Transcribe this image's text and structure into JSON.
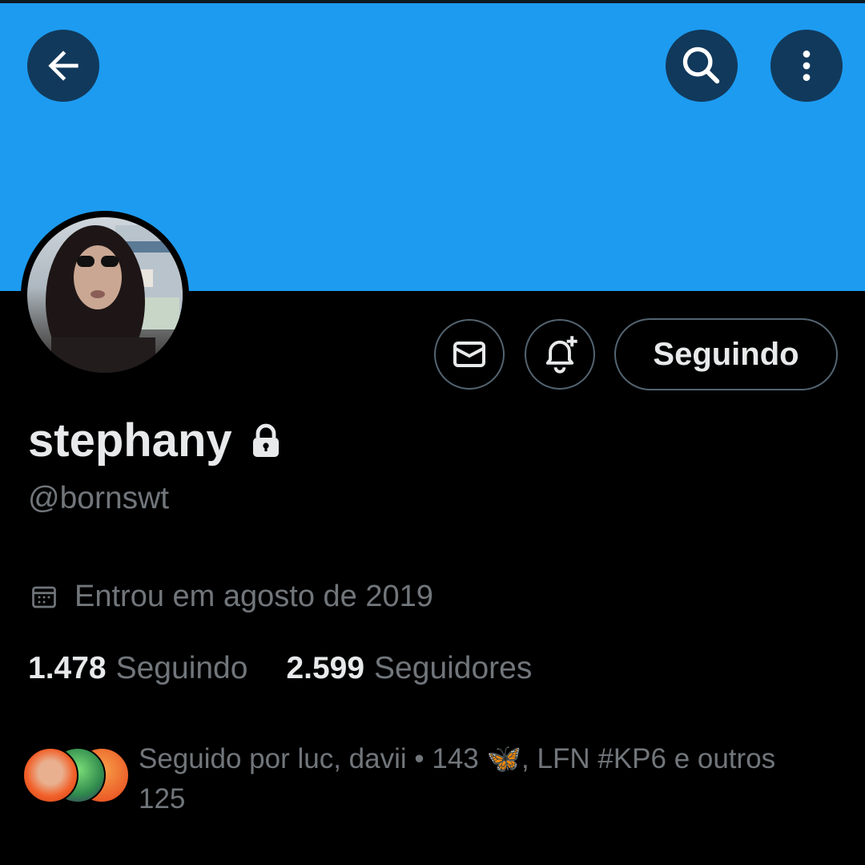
{
  "header": {
    "banner_color": "#1d9bf0",
    "back_icon": "arrow-left-icon",
    "search_icon": "search-icon",
    "more_icon": "more-vertical-icon"
  },
  "profile": {
    "display_name": "stephany",
    "protected_icon": "lock-icon",
    "handle": "@bornswt",
    "joined": "Entrou em agosto de 2019",
    "joined_icon": "calendar-icon"
  },
  "actions": {
    "message_icon": "mail-icon",
    "notify_icon": "bell-plus-icon",
    "follow_label": "Seguindo"
  },
  "stats": {
    "following_count": "1.478",
    "following_label": "Seguindo",
    "followers_count": "2.599",
    "followers_label": "Seguidores"
  },
  "followed_by": {
    "text": "Seguido por luc, davii • 143 🦋, LFN #KP6 e outros 125"
  },
  "colors": {
    "accent": "#1d9bf0",
    "muted_text": "#71767b",
    "primary_text": "#e7e9ea",
    "border": "#536471"
  }
}
